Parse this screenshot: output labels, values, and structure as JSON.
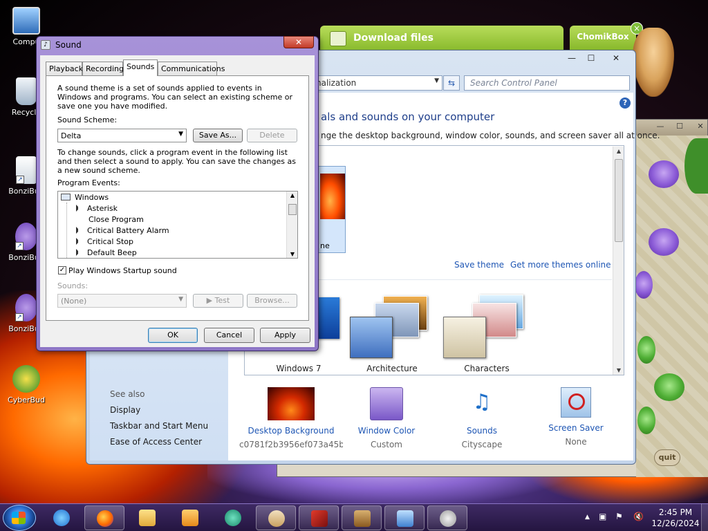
{
  "desktop": {
    "icons": [
      {
        "label": "Compu"
      },
      {
        "label": "Recycle"
      },
      {
        "label": "BonziBud"
      },
      {
        "label": "BonziBud"
      },
      {
        "label": "BonziBud"
      },
      {
        "label": "CyberBud"
      }
    ]
  },
  "chomikbox": {
    "download_tab": "Download files",
    "app_tab": "ChomikBox",
    "close": "×"
  },
  "game": {
    "quit": "quit",
    "controls": [
      "—",
      "☐",
      "✕"
    ]
  },
  "control_panel": {
    "controls": [
      "—",
      "☐",
      "✕"
    ],
    "address": "nalization",
    "search_placeholder": "Search Control Panel",
    "heading": "als and sounds on your computer",
    "subheading": "nge the desktop background, window color, sounds, and screen saver all at once.",
    "selected_theme_label": "ne",
    "save_theme": "Save theme",
    "get_more_themes": "Get more themes online",
    "themes": [
      "Windows 7",
      "Architecture",
      "Characters"
    ],
    "see_also": "See also",
    "left_links": [
      "Display",
      "Taskbar and Start Menu",
      "Ease of Access Center"
    ],
    "bottom_items": [
      {
        "title": "Desktop Background",
        "subtitle": "c0781f2b3956ef073a45b..."
      },
      {
        "title": "Window Color",
        "subtitle": "Custom"
      },
      {
        "title": "Sounds",
        "subtitle": "Cityscape"
      },
      {
        "title": "Screen Saver",
        "subtitle": "None"
      }
    ]
  },
  "sound_dialog": {
    "title": "Sound",
    "close": "✕",
    "tabs": [
      "Playback",
      "Recording",
      "Sounds",
      "Communications"
    ],
    "active_tab": "Sounds",
    "intro": "A sound theme is a set of sounds applied to events in Windows and programs.  You can select an existing scheme or save one you have modified.",
    "scheme_label": "Sound Scheme:",
    "scheme_value": "Delta",
    "save_as": "Save As...",
    "delete": "Delete",
    "instructions": "To change sounds, click a program event in the following list and then select a sound to apply.  You can save the changes as a new sound scheme.",
    "events_label": "Program Events:",
    "events": [
      {
        "label": "Windows",
        "has_sound": false,
        "root": true
      },
      {
        "label": "Asterisk",
        "has_sound": true
      },
      {
        "label": "Close Program",
        "has_sound": false
      },
      {
        "label": "Critical Battery Alarm",
        "has_sound": true
      },
      {
        "label": "Critical Stop",
        "has_sound": true
      },
      {
        "label": "Default Beep",
        "has_sound": true
      }
    ],
    "startup_checkbox_label": "Play Windows Startup sound",
    "startup_checked": true,
    "sounds_label": "Sounds:",
    "sounds_value": "(None)",
    "test": "Test",
    "browse": "Browse...",
    "ok": "OK",
    "cancel": "Cancel",
    "apply": "Apply"
  },
  "taskbar": {
    "clock_time": "2:45 PM",
    "clock_date": "12/26/2024",
    "tray_up": "▲"
  },
  "colors": {
    "sound_frame": "#8d76c6",
    "link": "#1e56b4",
    "chomik_green": "#86b82a",
    "taskbar": "#241540"
  }
}
